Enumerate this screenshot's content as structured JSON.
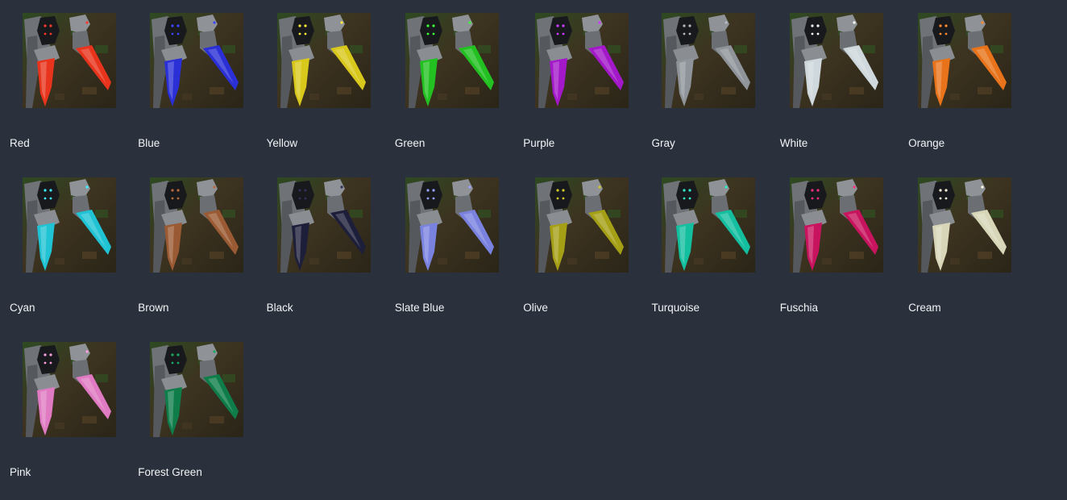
{
  "variants": [
    {
      "label": "Red",
      "color": "#e8341c",
      "eye": "#ff3a2a"
    },
    {
      "label": "Blue",
      "color": "#2a2fd6",
      "eye": "#3e46ff"
    },
    {
      "label": "Yellow",
      "color": "#d9c81c",
      "eye": "#ffe93a"
    },
    {
      "label": "Green",
      "color": "#22c021",
      "eye": "#3dff3a"
    },
    {
      "label": "Purple",
      "color": "#a318c9",
      "eye": "#d23bff"
    },
    {
      "label": "Gray",
      "color": "#8e9499",
      "eye": "#b5bcc1"
    },
    {
      "label": "White",
      "color": "#cfd8dc",
      "eye": "#ffffff"
    },
    {
      "label": "Orange",
      "color": "#e8731a",
      "eye": "#ff8b2c"
    },
    {
      "label": "Cyan",
      "color": "#1fc3d4",
      "eye": "#3ff0ff"
    },
    {
      "label": "Brown",
      "color": "#9a5a33",
      "eye": "#b86b3c"
    },
    {
      "label": "Black",
      "color": "#1d1e3a",
      "eye": "#2f3158"
    },
    {
      "label": "Slate Blue",
      "color": "#7a82e0",
      "eye": "#9aa2ff"
    },
    {
      "label": "Olive",
      "color": "#a59f16",
      "eye": "#d0c82c"
    },
    {
      "label": "Turquoise",
      "color": "#14bfa0",
      "eye": "#2ff0c8"
    },
    {
      "label": "Fuschia",
      "color": "#c8145e",
      "eye": "#ff2f82"
    },
    {
      "label": "Cream",
      "color": "#d8d6b8",
      "eye": "#fffce0"
    },
    {
      "label": "Pink",
      "color": "#e07ac2",
      "eye": "#ff9de0"
    },
    {
      "label": "Forest Green",
      "color": "#0f7d4a",
      "eye": "#1aa862"
    }
  ]
}
